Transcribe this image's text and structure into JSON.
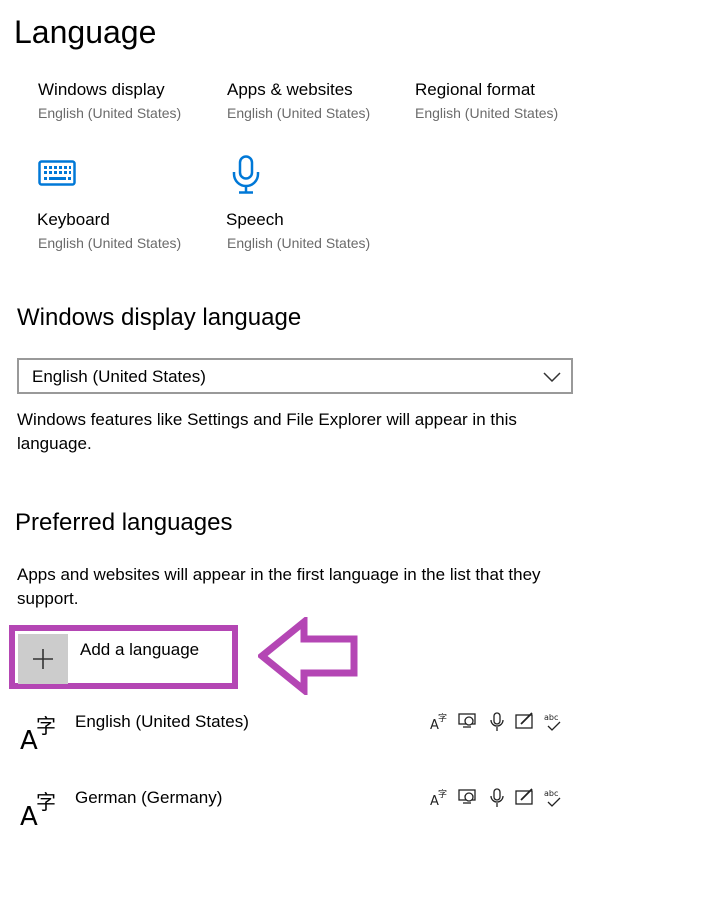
{
  "page": {
    "title": "Language"
  },
  "tiles": [
    {
      "title": "Windows display",
      "subtitle": "English (United States)"
    },
    {
      "title": "Apps & websites",
      "subtitle": "English (United States)"
    },
    {
      "title": "Regional format",
      "subtitle": "English (United States)"
    },
    {
      "title": "Keyboard",
      "subtitle": "English (United States)",
      "icon": "keyboard-icon"
    },
    {
      "title": "Speech",
      "subtitle": "English (United States)",
      "icon": "microphone-icon"
    }
  ],
  "display_language": {
    "heading": "Windows display language",
    "selected": "English (United States)",
    "description": "Windows features like Settings and File Explorer will appear in this language."
  },
  "preferred": {
    "heading": "Preferred languages",
    "description": "Apps and websites will appear in the first language in the list that they support.",
    "add_label": "Add a language",
    "languages": [
      {
        "name": "English (United States)"
      },
      {
        "name": "German (Germany)"
      }
    ]
  },
  "colors": {
    "accent": "#0078d7",
    "highlight": "#b446b4",
    "subtext": "#6b6b6b"
  }
}
